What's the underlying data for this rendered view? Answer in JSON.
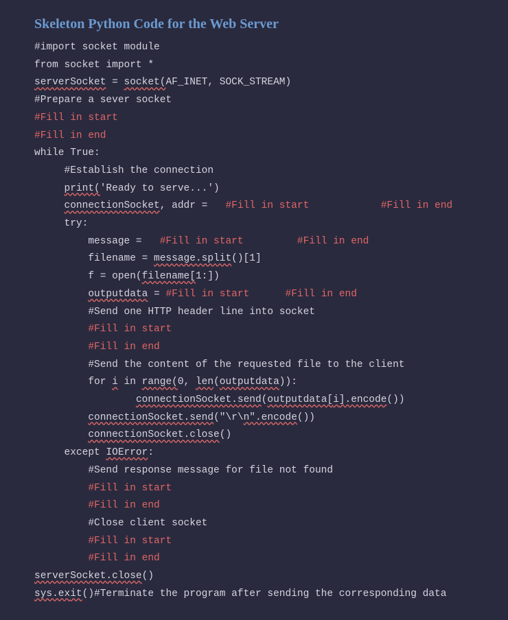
{
  "title": "Skeleton Python Code for the Web Server",
  "fill_start": "#Fill in start",
  "fill_end": "#Fill in end",
  "lines": {
    "l1": "#import socket module",
    "l2": "from socket import *",
    "l3a": "serverSocket",
    "l3b": " = ",
    "l3c": "socket(",
    "l3d": "AF_INET, SOCK_STREAM)",
    "l4": "#Prepare a sever socket",
    "l7": "while True:",
    "l8": "     #Establish the connection",
    "l9a": "     ",
    "l9b": "print(",
    "l9c": "'Ready to serve...')",
    "l10a": "     ",
    "l10b": "connectionSocket",
    "l10c": ", addr =   ",
    "l11": "     try:",
    "l12a": "         message =   ",
    "l13a": "         filename = ",
    "l13b": "message.split",
    "l13c": "()[1]",
    "l14a": "         f = open(",
    "l14b": "filename[",
    "l14c": "1:])",
    "l15a": "         ",
    "l15b": "outputdata",
    "l15c": " = ",
    "l16": "         #Send one HTTP header line into socket",
    "l19": "         #Send the content of the requested file to the client",
    "l20a": "         for ",
    "l20b": "i",
    "l20c": " in ",
    "l20d": "range(",
    "l20e": "0, ",
    "l20f": "len",
    "l20g": "(",
    "l20h": "outputdata",
    "l20i": ")):",
    "l21a": "                 ",
    "l21b": "connectionSocket.send",
    "l21c": "(",
    "l21d": "outputdata[",
    "l21e": "i",
    "l21f": "].encode",
    "l21g": "())",
    "l22a": "         ",
    "l22b": "connectionSocket.send",
    "l22c": "(\"\\r\\",
    "l22d": "n\".encode",
    "l22e": "())",
    "l23a": "         ",
    "l23b": "connectionSocket.close",
    "l23c": "()",
    "l24a": "     except ",
    "l24b": "IOError",
    "l24c": ":",
    "l25": "         #Send response message for file not found",
    "l28": "         #Close client socket",
    "l31a": "serverSocket.close",
    "l31b": "()",
    "l32a": "sys.ex",
    "l32b": "it",
    "l32c": "()#Terminate the program after sending the corresponding data",
    "indent9": "         ",
    "space_med": "            ",
    "space_sm": "         ",
    "space_lg": "      "
  }
}
